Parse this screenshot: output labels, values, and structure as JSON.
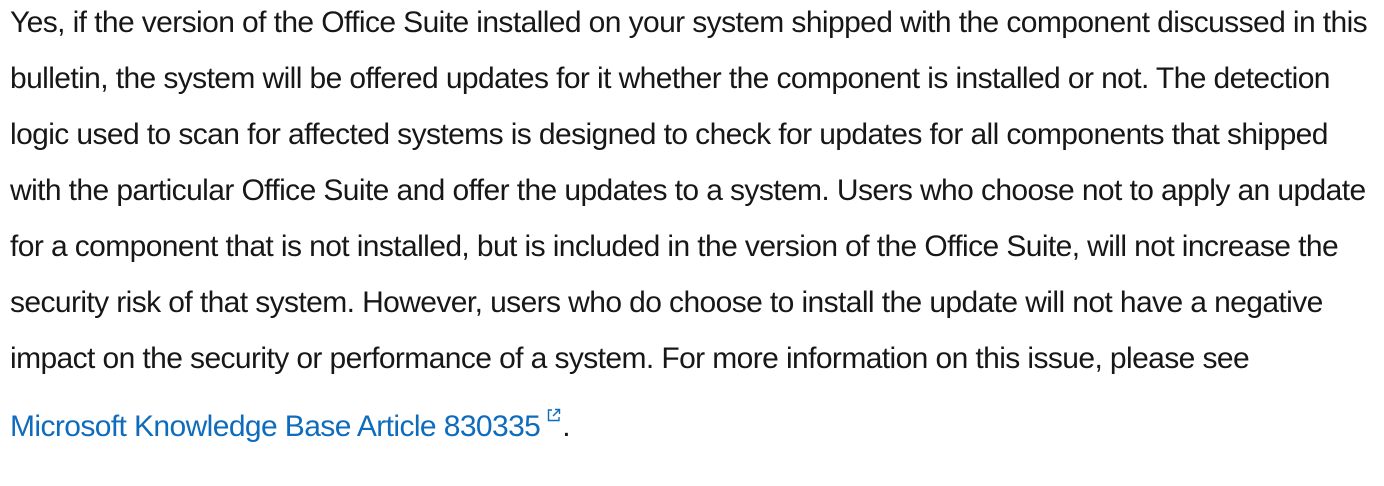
{
  "article": {
    "paragraph_text": "Yes, if the version of the Office Suite installed on your system shipped with the component discussed in this bulletin, the system will be offered updates for it whether the component is installed or not. The detection logic used to scan for affected systems is designed to check for updates for all components that shipped with the particular Office Suite and offer the updates to a system. Users who choose not to apply an update for a component that is not installed, but is included in the version of the Office Suite, will not increase the security risk of that system. However, users who do choose to install the update will not have a negative impact on the security or performance of a system. For more information on this issue, please see ",
    "link_text": "Microsoft Knowledge Base Article 830335",
    "link_icon": "external-link-icon",
    "trailing_text": ".",
    "link_color": "#0f6cbd",
    "text_color": "#171717"
  }
}
